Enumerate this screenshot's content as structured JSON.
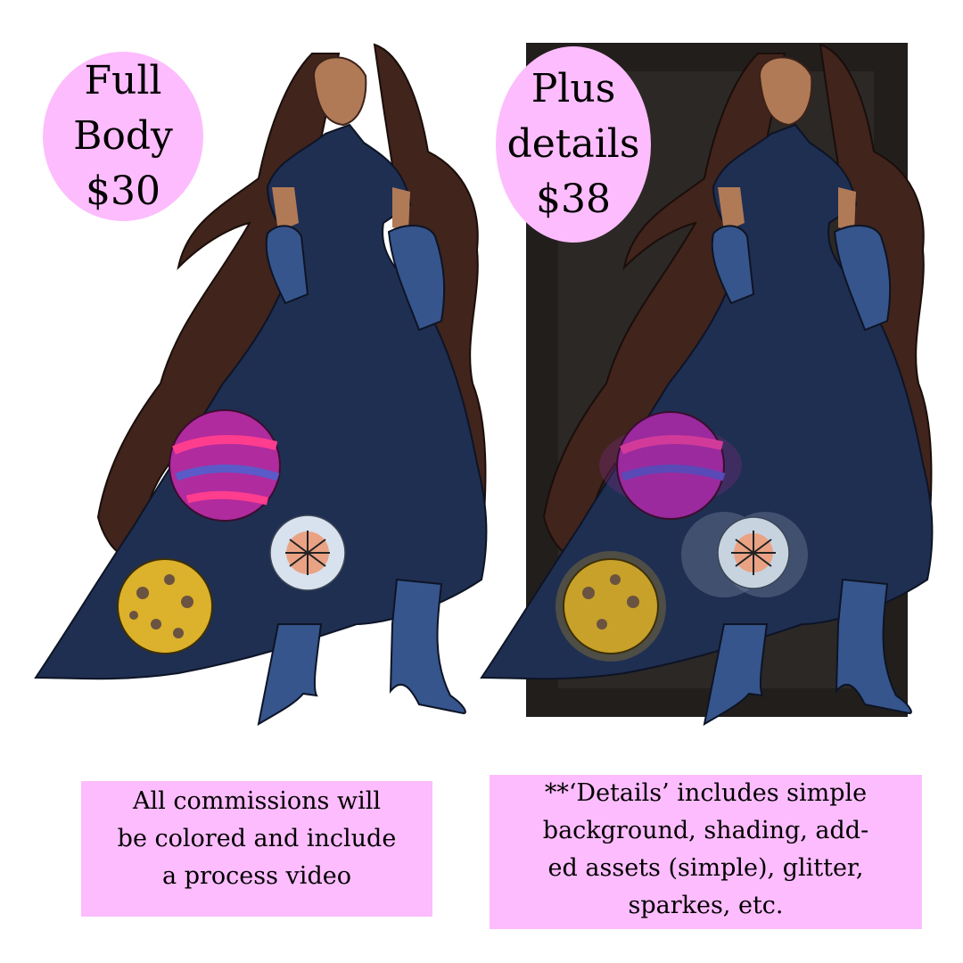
{
  "panels": {
    "left": {
      "price_lines": [
        "Full",
        "Body",
        "$30"
      ]
    },
    "right": {
      "price_lines": [
        "Plus",
        "details",
        "$38"
      ]
    }
  },
  "notes": {
    "left": [
      "All commissions will",
      "be colored and include",
      "a process video"
    ],
    "right": [
      "**‘Details’ includes simple",
      "background, shading, add-",
      "ed assets (simple), glitter,",
      "sparkes, etc."
    ]
  },
  "colors": {
    "badge": "#fdbcfd",
    "dress": "#1f2f52",
    "hair": "#41241c",
    "gloves": "#36558c",
    "background_frame": "#221e1c"
  }
}
